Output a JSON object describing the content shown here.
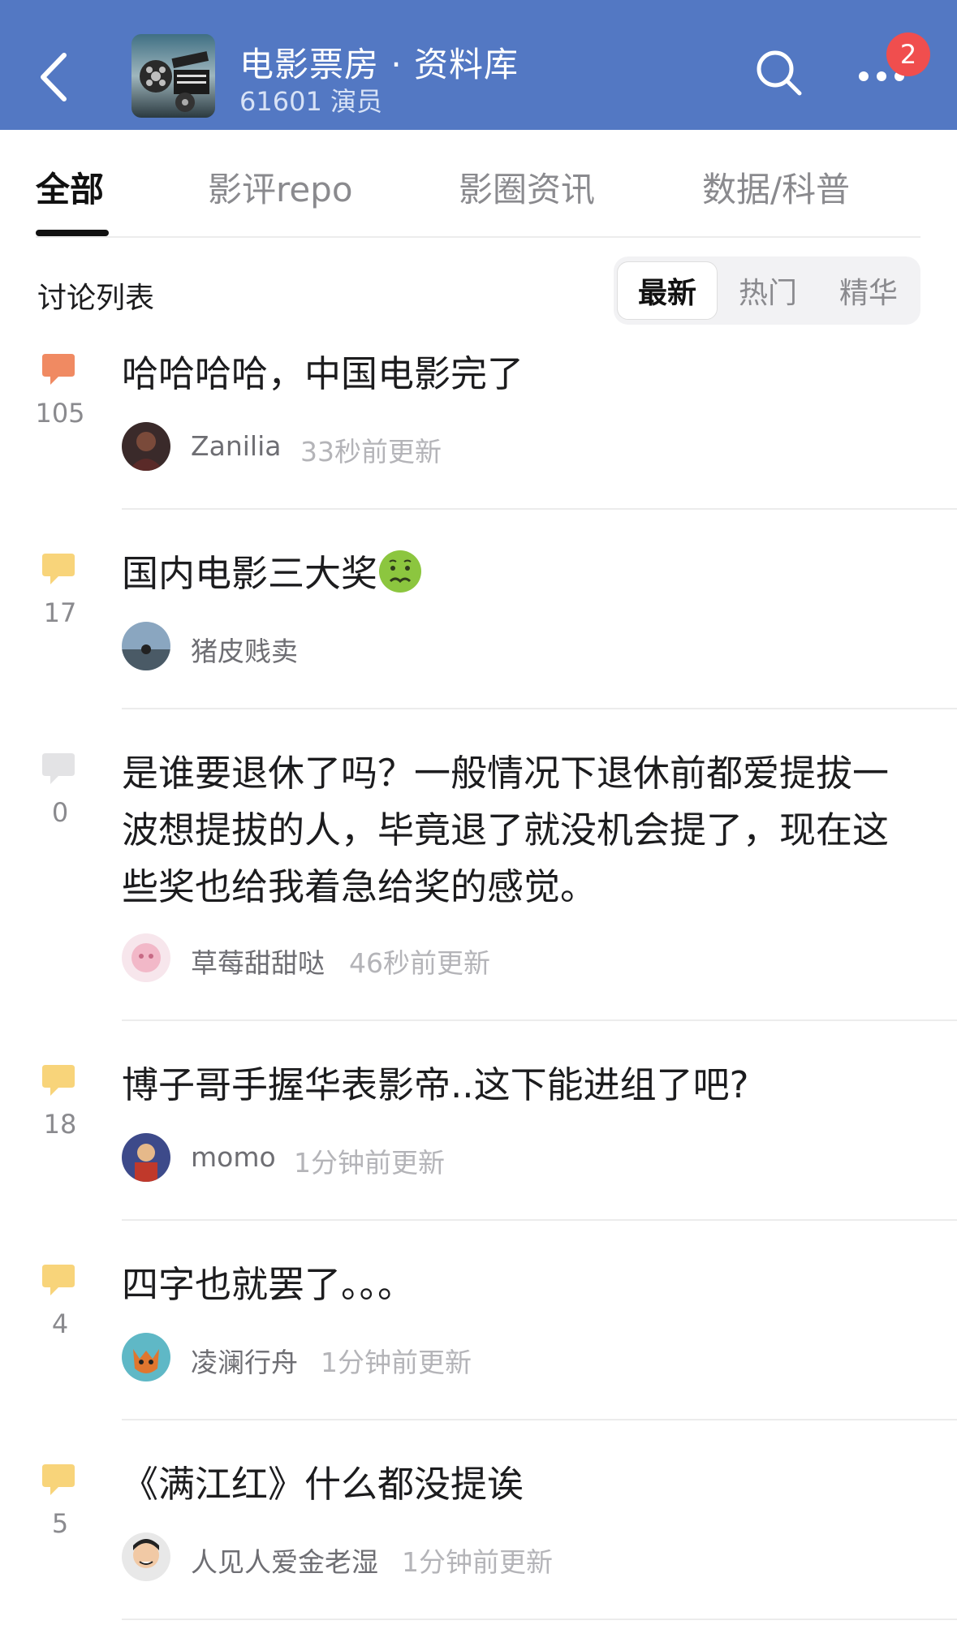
{
  "header": {
    "title": "电影票房 · 资料库",
    "subtitle": "61601 演员",
    "badge_count": "2",
    "bg_color": "#5378c3",
    "icons": [
      "back-icon",
      "search-icon",
      "more-icon"
    ]
  },
  "tabs": [
    {
      "label": "全部",
      "active": true
    },
    {
      "label": "影评repo",
      "active": false
    },
    {
      "label": "影圈资讯",
      "active": false
    },
    {
      "label": "数据/科普",
      "active": false
    }
  ],
  "list": {
    "title": "讨论列表",
    "sort_options": [
      {
        "label": "最新",
        "active": true
      },
      {
        "label": "热门",
        "active": false
      },
      {
        "label": "精华",
        "active": false
      }
    ]
  },
  "posts": [
    {
      "title": "哈哈哈哈，中国电影完了",
      "comments": "105",
      "author": "Zanilia",
      "time": "33秒前更新",
      "icon_color": "#f08a62"
    },
    {
      "title": "国内电影三大奖",
      "emoji": "nauseated-face-emoji",
      "comments": "17",
      "author": "猪皮贱卖",
      "time": "",
      "icon_color": "#f8d47a"
    },
    {
      "title": "是谁要退休了吗？一般情况下退休前都爱提拔一波想提拔的人，毕竟退了就没机会提了，现在这些奖也给我着急给奖的感觉。",
      "comments": "0",
      "author": "草莓甜甜哒",
      "time": "46秒前更新",
      "icon_color": "#e3e3e5"
    },
    {
      "title": "博子哥手握华表影帝..这下能进组了吧?",
      "comments": "18",
      "author": "momo",
      "time": "1分钟前更新",
      "icon_color": "#f8d47a"
    },
    {
      "title": "四字也就罢了。。。",
      "comments": "4",
      "author": "凌澜行舟",
      "time": "1分钟前更新",
      "icon_color": "#f8d47a"
    },
    {
      "title": "《满江红》什么都没提诶",
      "comments": "5",
      "author": "人见人爱金老湿",
      "time": "1分钟前更新",
      "icon_color": "#f8d47a"
    }
  ]
}
